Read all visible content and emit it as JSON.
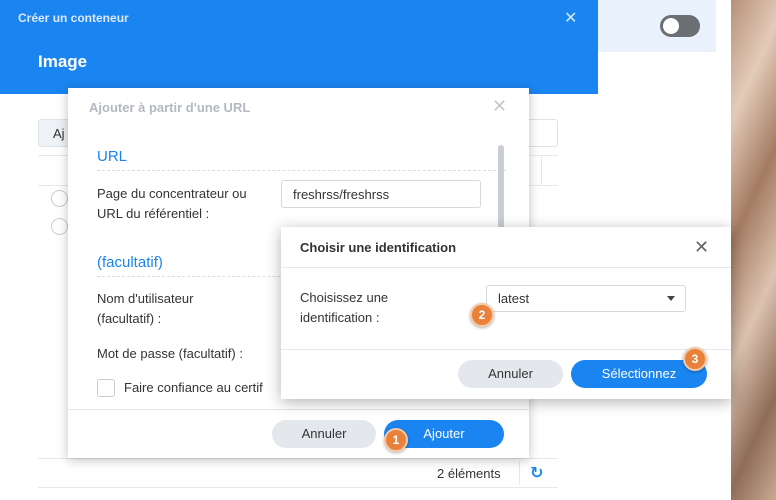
{
  "background": {
    "toggle_state": "off"
  },
  "main_window": {
    "title": "Créer un conteneur",
    "close_glyph": "✕",
    "subtitle": "Image",
    "tab_partial_label": "Aj",
    "item_count": "2 éléments",
    "refresh_icon": "refresh-icon"
  },
  "url_dialog": {
    "title": "Ajouter à partir d'une URL",
    "close_glyph": "✕",
    "section_url": "URL",
    "hub_label_line1": "Page du concentrateur ou",
    "hub_label_line2": "URL du référentiel :",
    "hub_value": "freshrss/freshrss",
    "section_optional": "(facultatif)",
    "username_label_line1": "Nom d'utilisateur",
    "username_label_line2": "(facultatif) :",
    "password_label": "Mot de passe (facultatif) :",
    "trust_label": "Faire confiance au certif",
    "cancel_label": "Annuler",
    "add_label": "Ajouter"
  },
  "tag_dialog": {
    "title": "Choisir une identification",
    "close_glyph": "✕",
    "choose_label_line1": "Choisissez une",
    "choose_label_line2": "identification :",
    "selected_tag": "latest",
    "cancel_label": "Annuler",
    "select_label": "Sélectionnez"
  },
  "badges": {
    "one": "1",
    "two": "2",
    "three": "3"
  },
  "colors": {
    "accent": "#1a85f0",
    "badge": "#e8823a"
  }
}
